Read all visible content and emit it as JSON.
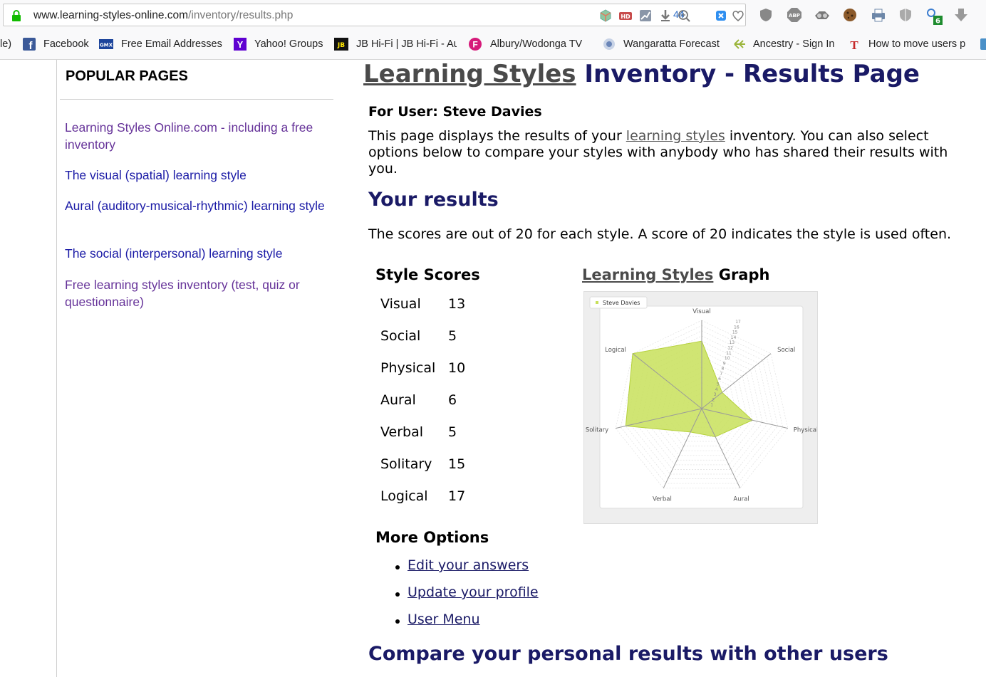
{
  "browser": {
    "url_domain": "www.learning-styles-online.com",
    "url_path": "/inventory/results.php",
    "badge_count": "44",
    "extension_badge": "6",
    "bookmarks": [
      {
        "label": "le)",
        "icon": "bookmark-truncated"
      },
      {
        "label": "Facebook",
        "icon": "facebook-icon"
      },
      {
        "label": "Free Email Addresses",
        "icon": "gmx-icon"
      },
      {
        "label": "Yahoo! Groups",
        "icon": "yahoo-icon"
      },
      {
        "label": "JB Hi-Fi | JB Hi-Fi - Au",
        "icon": "jbhifi-icon"
      },
      {
        "label": "Albury/Wodonga TV",
        "icon": "tv-icon"
      },
      {
        "label": "Wangaratta Forecast",
        "icon": "weather-icon"
      },
      {
        "label": "Ancestry - Sign In",
        "icon": "ancestry-icon"
      },
      {
        "label": "How to move users p",
        "icon": "t-icon"
      }
    ]
  },
  "sidebar": {
    "heading": "POPULAR PAGES",
    "links": [
      {
        "label": "Learning Styles Online.com - including a free inventory"
      },
      {
        "label": "The visual (spatial) learning style"
      },
      {
        "label": "Aural (auditory-musical-rhythmic) learning style"
      },
      {
        "label": "The social (interpersonal) learning style"
      },
      {
        "label": "Free learning styles inventory (test, quiz or questionnaire)"
      }
    ]
  },
  "main": {
    "title_link": "Learning Styles",
    "title_rest": " Inventory - Results Page",
    "for_user": "For User: Steve Davies",
    "intro_before": "This page displays the results of your ",
    "intro_link": "learning styles",
    "intro_after": " inventory. You can also select options below to compare your styles with anybody who has shared their results with you.",
    "your_results": "Your results",
    "scores_note": "The scores are out of 20 for each style. A score of 20 indicates the style is used often.",
    "style_scores_heading": "Style Scores",
    "scores": [
      {
        "style": "Visual",
        "score": "13"
      },
      {
        "style": "Social",
        "score": "5"
      },
      {
        "style": "Physical",
        "score": "10"
      },
      {
        "style": "Aural",
        "score": "6"
      },
      {
        "style": "Verbal",
        "score": "5"
      },
      {
        "style": "Solitary",
        "score": "15"
      },
      {
        "style": "Logical",
        "score": "17"
      }
    ],
    "graph_title_link": "Learning Styles",
    "graph_title_rest": " Graph",
    "more_options_heading": "More Options",
    "options": [
      {
        "label": "Edit your answers"
      },
      {
        "label": "Update your profile"
      },
      {
        "label": "User Menu"
      }
    ],
    "compare_heading": "Compare your personal results with other users"
  },
  "chart_data": {
    "type": "radar",
    "categories": [
      "Visual",
      "Social",
      "Physical",
      "Aural",
      "Verbal",
      "Solitary",
      "Logical"
    ],
    "series": [
      {
        "name": "Steve Davies",
        "values": [
          13,
          5,
          10,
          6,
          5,
          15,
          17
        ]
      }
    ],
    "rlim": [
      0,
      17
    ],
    "legend": "top-left",
    "grid": true,
    "colors": {
      "fill": "#c8e05a",
      "line": "#b5d13b"
    }
  }
}
